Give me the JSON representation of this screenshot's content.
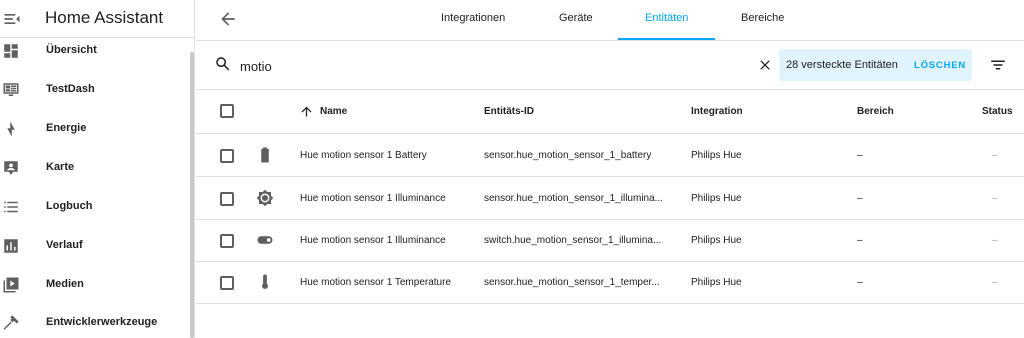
{
  "sidebar": {
    "title": "Home Assistant",
    "items": [
      {
        "label": "Übersicht",
        "icon": "dashboard-icon"
      },
      {
        "label": "TestDash",
        "icon": "monitor-dashboard-icon"
      },
      {
        "label": "Energie",
        "icon": "lightning-bolt-icon"
      },
      {
        "label": "Karte",
        "icon": "account-box-icon"
      },
      {
        "label": "Logbuch",
        "icon": "format-list-bulleted-icon"
      },
      {
        "label": "Verlauf",
        "icon": "chart-box-icon"
      },
      {
        "label": "Medien",
        "icon": "play-box-multiple-icon"
      },
      {
        "label": "Entwicklerwerkzeuge",
        "icon": "hammer-icon"
      }
    ]
  },
  "tabs": [
    {
      "label": "Integrationen",
      "active": false
    },
    {
      "label": "Geräte",
      "active": false
    },
    {
      "label": "Entitäten",
      "active": true
    },
    {
      "label": "Bereiche",
      "active": false
    }
  ],
  "search": {
    "value": "motio",
    "hidden_entities_text": "28 versteckte Entitäten",
    "clear_button": "LÖSCHEN"
  },
  "table": {
    "columns": {
      "name": "Name",
      "entity_id": "Entitäts-ID",
      "integration": "Integration",
      "area": "Bereich",
      "status": "Status"
    },
    "rows": [
      {
        "icon": "battery-icon",
        "name": "Hue motion sensor 1 Battery",
        "entity_id": "sensor.hue_motion_sensor_1_battery",
        "integration": "Philips Hue",
        "area": "–",
        "status": "–"
      },
      {
        "icon": "brightness-icon",
        "name": "Hue motion sensor 1 Illuminance",
        "entity_id": "sensor.hue_motion_sensor_1_illumina...",
        "integration": "Philips Hue",
        "area": "–",
        "status": "–"
      },
      {
        "icon": "toggle-switch-icon",
        "name": "Hue motion sensor 1 Illuminance",
        "entity_id": "switch.hue_motion_sensor_1_illumina...",
        "integration": "Philips Hue",
        "area": "–",
        "status": "–"
      },
      {
        "icon": "thermometer-icon",
        "name": "Hue motion sensor 1 Temperature",
        "entity_id": "sensor.hue_motion_sensor_1_temper...",
        "integration": "Philips Hue",
        "area": "–",
        "status": "–"
      }
    ]
  },
  "colors": {
    "accent": "#03a9f4",
    "hidden_box_bg": "#e1f3fc",
    "icon_gray": "#5f5f5f"
  }
}
